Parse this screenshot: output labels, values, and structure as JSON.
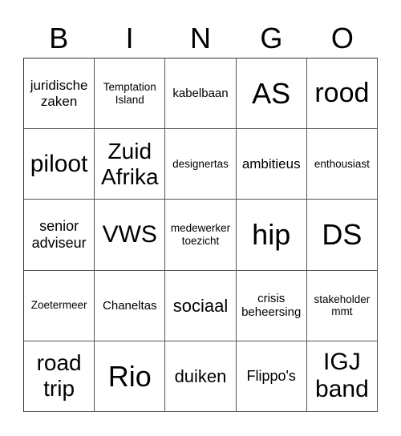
{
  "header": [
    "B",
    "I",
    "N",
    "G",
    "O"
  ],
  "cells": [
    [
      "juridische zaken",
      "Temptation Island",
      "kabelbaan",
      "AS",
      "rood"
    ],
    [
      "piloot",
      "Zuid Afrika",
      "designertas",
      "ambitieus",
      "enthousiast"
    ],
    [
      "senior adviseur",
      "VWS",
      "medewerker toezicht",
      "hip",
      "DS"
    ],
    [
      "Zoetermeer",
      "Chaneltas",
      "sociaal",
      "crisis beheersing",
      "stakeholder mmt"
    ],
    [
      "road trip",
      "Rio",
      "duiken",
      "Flippo's",
      "IGJ band"
    ]
  ]
}
